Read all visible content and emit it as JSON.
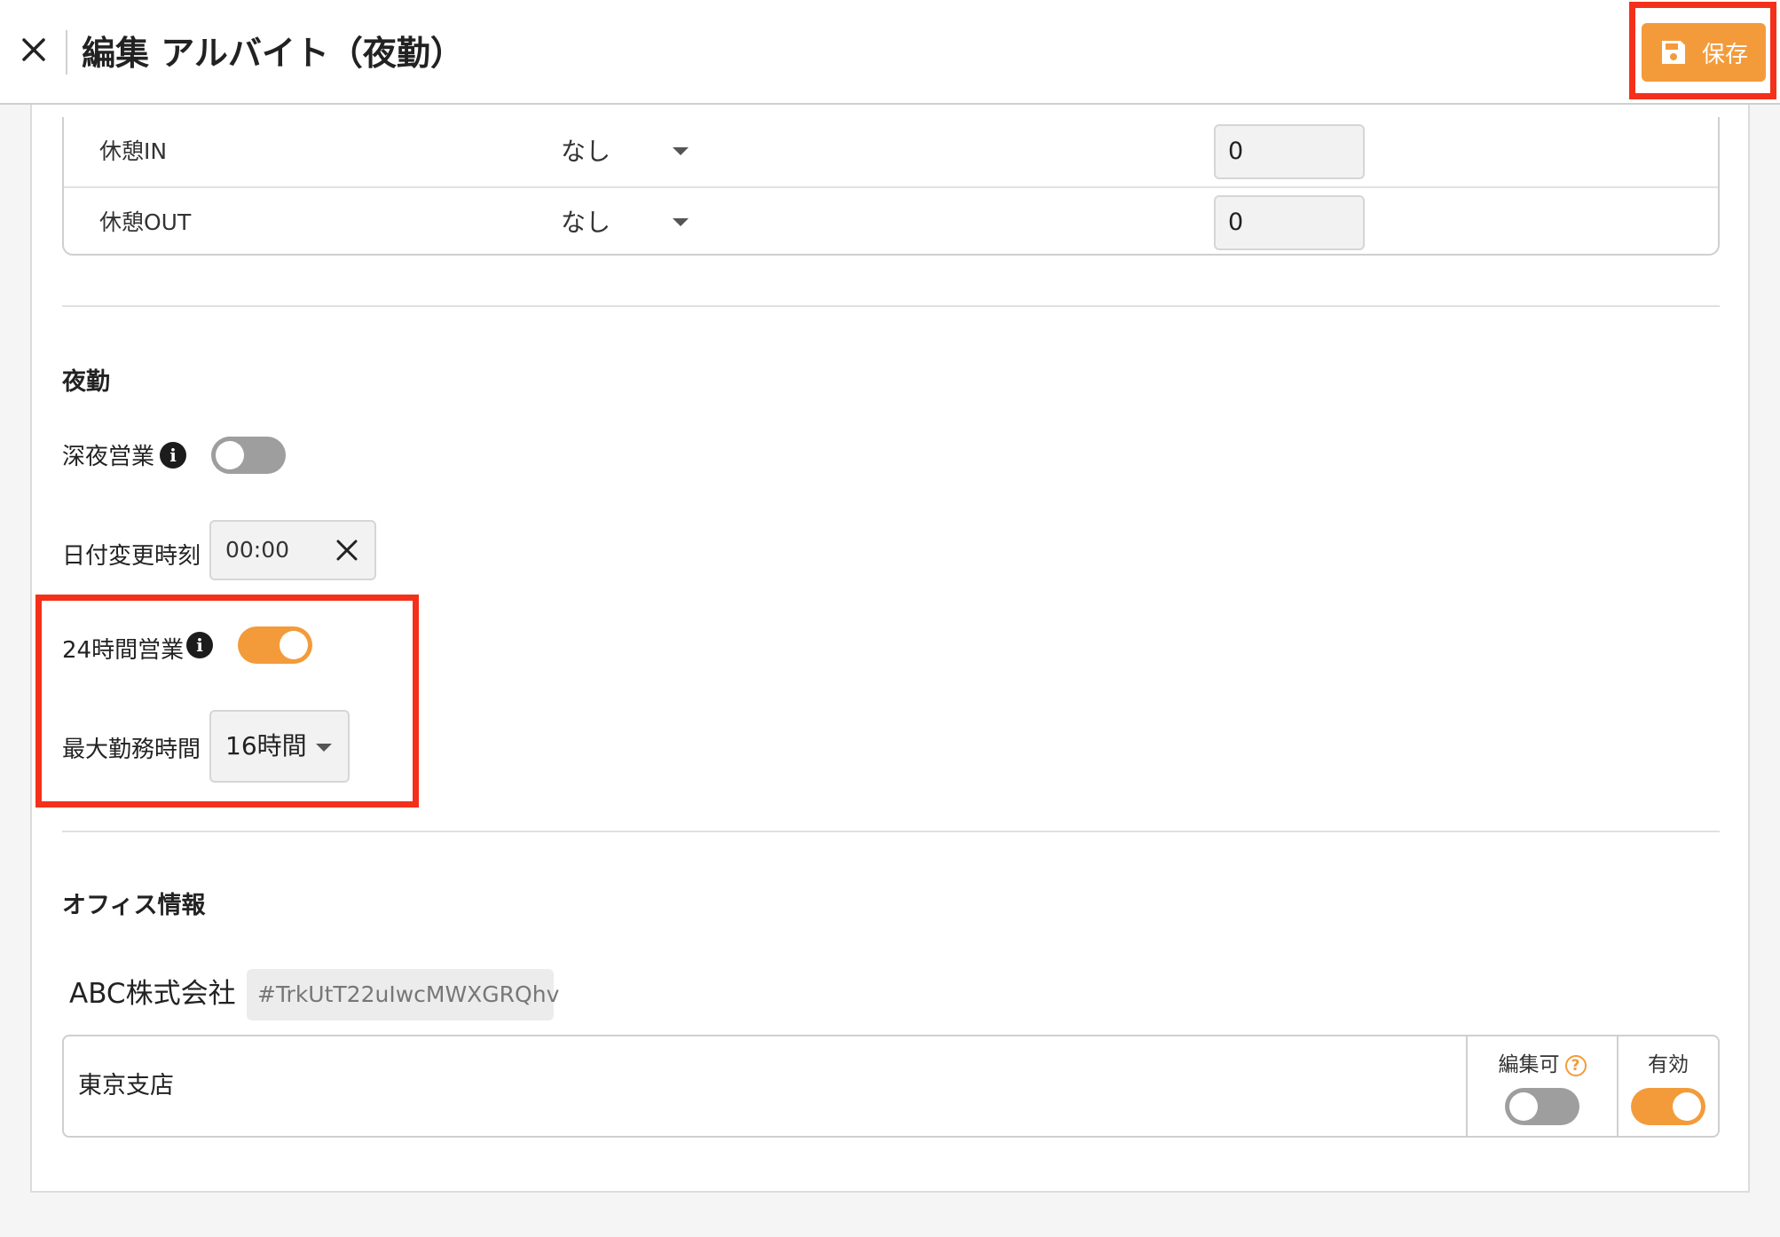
{
  "header": {
    "title": "編集 アルバイト（夜勤）",
    "save_label": "保存"
  },
  "breaks": [
    {
      "label": "休憩IN",
      "option": "なし",
      "value": "0"
    },
    {
      "label": "休憩OUT",
      "option": "なし",
      "value": "0"
    }
  ],
  "night_shift": {
    "section_title": "夜勤",
    "late_night_label": "深夜営業",
    "late_night_enabled": false,
    "date_change_label": "日付変更時刻",
    "date_change_time": "00:00",
    "all_day_label": "24時間営業",
    "all_day_enabled": true,
    "max_hours_label": "最大勤務時間",
    "max_hours_value": "16時間"
  },
  "office": {
    "section_title": "オフィス情報",
    "company_name": "ABC株式会社",
    "company_id": "#TrkUtT22uIwcMWXGRQhv",
    "branch": {
      "name": "東京支店",
      "editable_label": "編集可",
      "editable_enabled": false,
      "active_label": "有効",
      "active_enabled": true
    }
  },
  "colors": {
    "accent": "#f39b3a",
    "highlight": "#f4301b",
    "toggle_off": "#9e9e9e"
  }
}
